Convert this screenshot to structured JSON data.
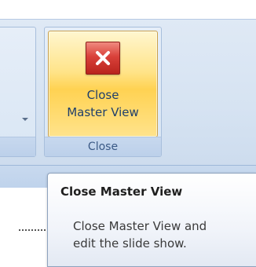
{
  "ribbon": {
    "close_button_label_line1": "Close",
    "close_button_label_line2": "Master View",
    "group_label": "Close"
  },
  "tooltip": {
    "title": "Close Master View",
    "description_line1": "Close Master View and",
    "description_line2": "edit the slide show."
  },
  "icons": {
    "close": "close-x-icon",
    "dropdown": "chevron-down-icon"
  },
  "colors": {
    "accent_hover": "#ffd252",
    "close_icon_red": "#d9413a",
    "ribbon_blue": "#d6e3f2",
    "label_text": "#1f3f6b"
  }
}
